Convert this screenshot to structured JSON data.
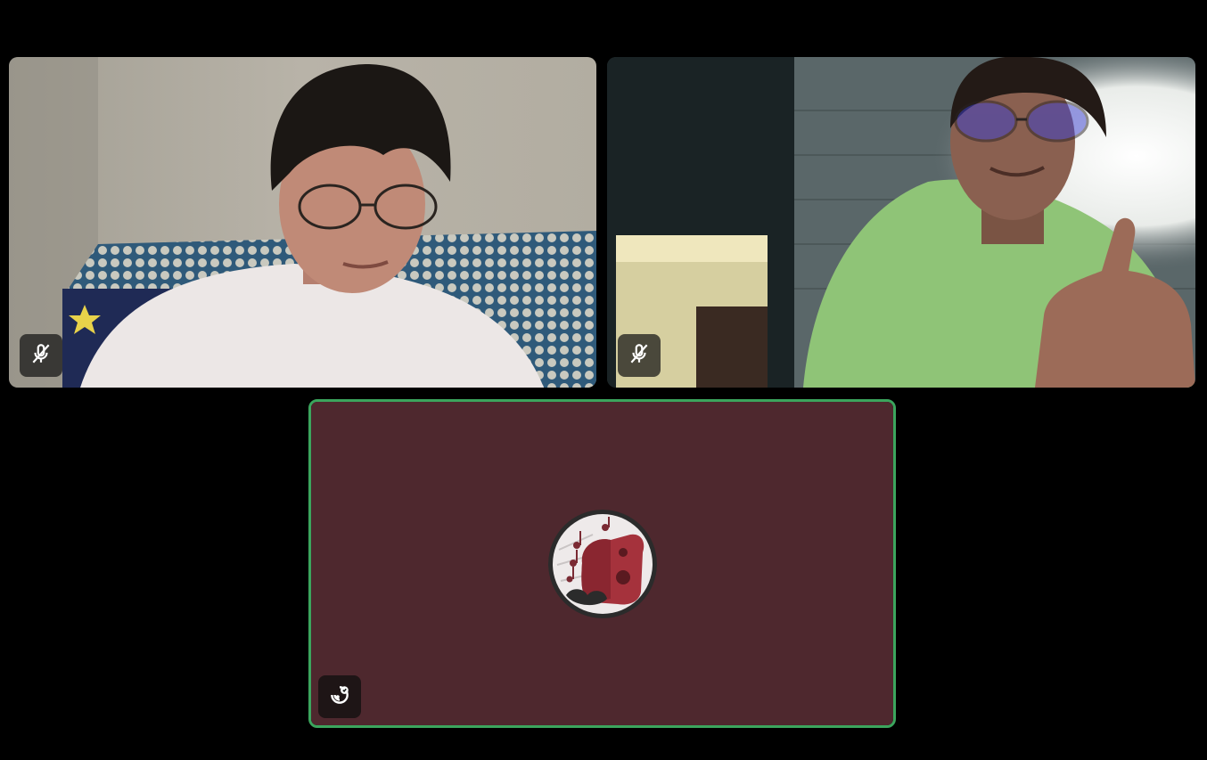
{
  "call": {
    "participants": [
      {
        "kind": "video",
        "muted": true,
        "shirt": "white",
        "status_icon": "microphone-muted-icon"
      },
      {
        "kind": "video",
        "muted": true,
        "shirt": "green",
        "status_icon": "microphone-muted-icon"
      },
      {
        "kind": "avatar",
        "speaking": true,
        "tile_color": "#4e282e",
        "speaking_border_color": "#3ba55d",
        "avatar_icon": "red-speaker-music-notes-icon",
        "status_icon": "activity-status-icon"
      }
    ]
  },
  "theme": {
    "background": "#000000",
    "badge_background": "#141414"
  }
}
